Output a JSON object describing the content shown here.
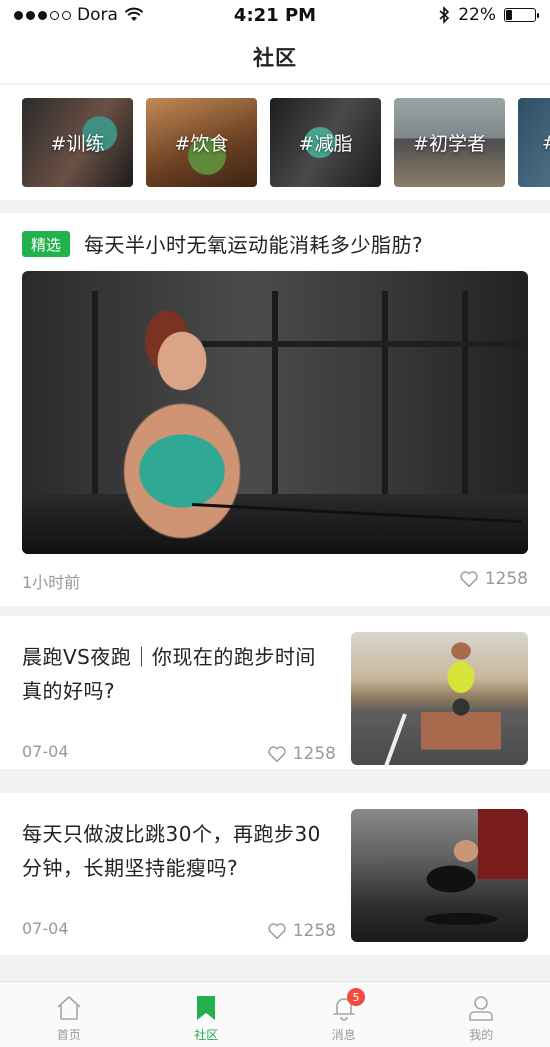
{
  "status_bar": {
    "carrier": "Dora",
    "time": "4:21 PM",
    "battery": "22%",
    "battery_level": 0.22,
    "signal_bars": 3
  },
  "nav": {
    "title": "社区"
  },
  "topics": [
    {
      "label": "#训练"
    },
    {
      "label": "#饮食"
    },
    {
      "label": "#减脂"
    },
    {
      "label": "#初学者"
    },
    {
      "label": "#"
    }
  ],
  "featured": {
    "badge": "精选",
    "title": "每天半小时无氧运动能消耗多少脂肪?",
    "time": "1小时前",
    "likes": "1258"
  },
  "articles": [
    {
      "title": "晨跑VS夜跑｜你现在的跑步时间真的好吗?",
      "date": "07-04",
      "likes": "1258"
    },
    {
      "title": "每天只做波比跳30个，再跑步30分钟，长期坚持能瘦吗?",
      "date": "07-04",
      "likes": "1258"
    }
  ],
  "tab_bar": {
    "tabs": [
      {
        "label": "首页",
        "icon": "home-icon"
      },
      {
        "label": "社区",
        "icon": "bookmark-icon"
      },
      {
        "label": "消息",
        "icon": "bell-icon",
        "badge": "5"
      },
      {
        "label": "我的",
        "icon": "user-icon"
      }
    ],
    "active_index": 1,
    "accent": "#22b14c"
  }
}
